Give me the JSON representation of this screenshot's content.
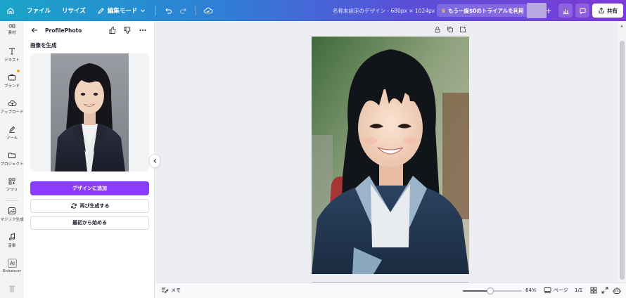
{
  "topbar": {
    "file_label": "ファイル",
    "resize_label": "リサイズ",
    "edit_mode_label": "編集モード",
    "design_title": "名称未設定のデザイン - 680px × 1024px",
    "trial_label": "もう一度$0のトライアルを利用",
    "plus_label": "+",
    "share_label": "共有"
  },
  "rail": {
    "items": [
      {
        "label": "素材"
      },
      {
        "label": "テキスト"
      },
      {
        "label": "ブランド"
      },
      {
        "label": "アップロード"
      },
      {
        "label": "ツール"
      },
      {
        "label": "プロジェクト"
      },
      {
        "label": "アプリ"
      },
      {
        "label": "マジック生成"
      },
      {
        "label": "音楽"
      },
      {
        "label": "Enhancer"
      }
    ]
  },
  "panel": {
    "title": "ProfilePhoto",
    "section_title": "画像を生成",
    "add_to_design": "デザインに追加",
    "regenerate": "再び生成する",
    "start_over": "最初から始める"
  },
  "bottombar": {
    "memo_label": "メモ",
    "zoom": "64%",
    "zoom_fraction": 0.47,
    "pages_label": "ページ",
    "page_count": "1/1"
  },
  "colors": {
    "primary_button": "#8b3dff",
    "topbar_start": "#1aa5c8",
    "topbar_end": "#7d3ad6"
  }
}
